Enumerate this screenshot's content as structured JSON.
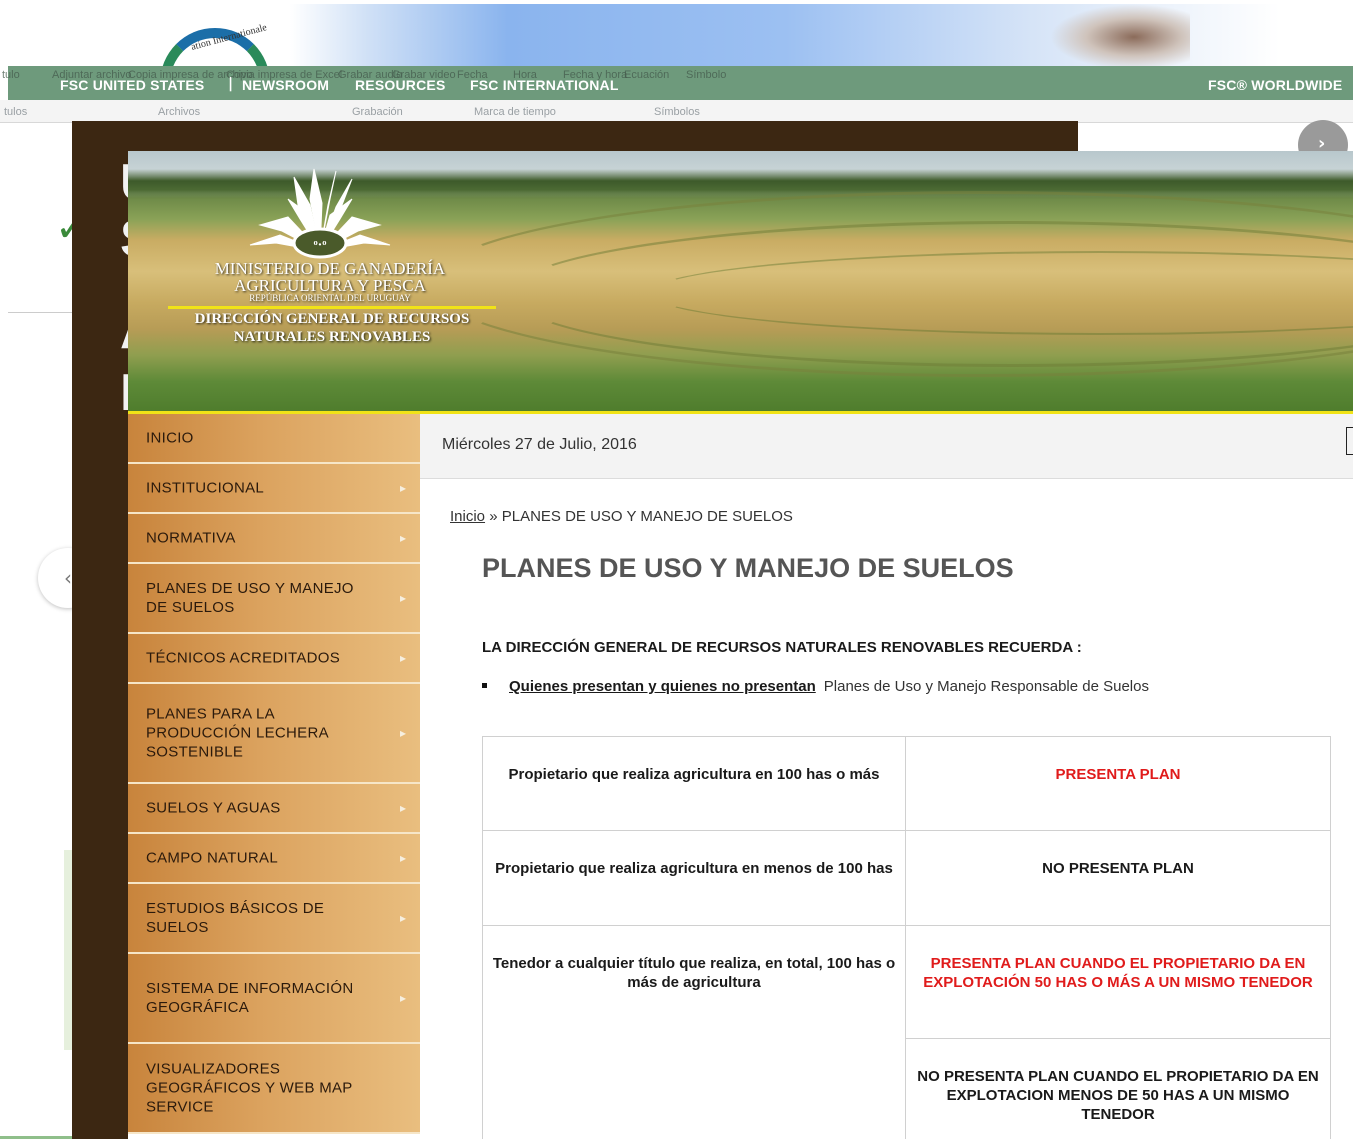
{
  "fsc_site": {
    "nav": {
      "left_label": "FSC UNITED STATES",
      "separator": "|",
      "items": [
        "NEWSROOM",
        "RESOURCES",
        "FSC INTERNATIONAL"
      ],
      "right_label": "FSC® WORLDWIDE"
    },
    "logo_text": "ation Internationale",
    "ghost_ribbon": [
      "tulo",
      "Adjuntar archivo",
      "Copia impresa de archivo",
      "Copia impresa de Excel",
      "Grabar audio",
      "Grabar video",
      "Fecha",
      "Hora",
      "Fecha y hora",
      "Ecuación",
      "Símbolo"
    ],
    "ghost_ribbon_groups": [
      "Archivos",
      "Grabación",
      "Marca de tiempo",
      "Símbolos"
    ],
    "ghost_small_left": "tulos",
    "big_letters": [
      "U",
      "S",
      "A",
      "I"
    ]
  },
  "header": {
    "ministry_l1": "MINISTERIO DE GANADERÍA",
    "ministry_l2": "AGRICULTURA Y PESCA",
    "ministry_l3": "REPÚBLICA ORIENTAL DEL URUGUAY",
    "ministry_l4": "DIRECCIÓN GENERAL DE RECURSOS",
    "ministry_l5": "NATURALES RENOVABLES"
  },
  "menu": [
    {
      "label": "INICIO",
      "arrow": ""
    },
    {
      "label": "INSTITUCIONAL",
      "arrow": "▸"
    },
    {
      "label": "NORMATIVA",
      "arrow": "▸"
    },
    {
      "label": "PLANES DE USO Y MANEJO DE SUELOS",
      "arrow": "▸"
    },
    {
      "label": "TÉCNICOS ACREDITADOS",
      "arrow": "▸"
    },
    {
      "label": "PLANES PARA LA PRODUCCIÓN LECHERA SOSTENIBLE",
      "arrow": "▸"
    },
    {
      "label": "SUELOS Y AGUAS",
      "arrow": "▸"
    },
    {
      "label": "CAMPO NATURAL",
      "arrow": "▸"
    },
    {
      "label": "ESTUDIOS BÁSICOS DE SUELOS",
      "arrow": "▸"
    },
    {
      "label": "SISTEMA DE INFORMACIÓN GEOGRÁFICA",
      "arrow": "▸"
    },
    {
      "label": "VISUALIZADORES GEOGRÁFICOS Y WEB MAP SERVICE",
      "arrow": ""
    }
  ],
  "date": "Miércoles 27 de Julio, 2016",
  "breadcrumb": {
    "home": "Inicio",
    "separator": "»",
    "current": "PLANES DE USO Y MANEJO DE SUELOS"
  },
  "page_title": "PLANES DE USO Y MANEJO DE SUELOS",
  "reminder": "LA DIRECCIÓN GENERAL DE RECURSOS NATURALES RENOVABLES RECUERDA :",
  "bullet": {
    "link": "Quienes presentan y quienes no presentan",
    "text": "Planes de Uso y Manejo Responsable de Suelos"
  },
  "table": {
    "row1_left": "Propietario que realiza agricultura en 100 has o más",
    "row1_right": "PRESENTA PLAN",
    "row2_left": "Propietario que realiza agricultura en menos de 100 has",
    "row2_right": "NO PRESENTA PLAN",
    "row3_left": "Tenedor a cualquier título que realiza, en total, 100 has o más de agricultura",
    "row3_right_a": "PRESENTA PLAN CUANDO EL PROPIETARIO DA EN EXPLOTACIÓN 50 HAS O MÁS A UN MISMO TENEDOR",
    "row3_right_b": "NO PRESENTA PLAN CUANDO EL PROPIETARIO DA EN EXPLOTACION MENOS DE 50 HAS A UN MISMO TENEDOR"
  },
  "colors": {
    "fsc_green": "#6e9a7c",
    "dark_frame": "#3c2712",
    "menu_orange": "#dba25e",
    "accent_yellow": "#f1e317",
    "alert_red": "#e01b1b"
  }
}
